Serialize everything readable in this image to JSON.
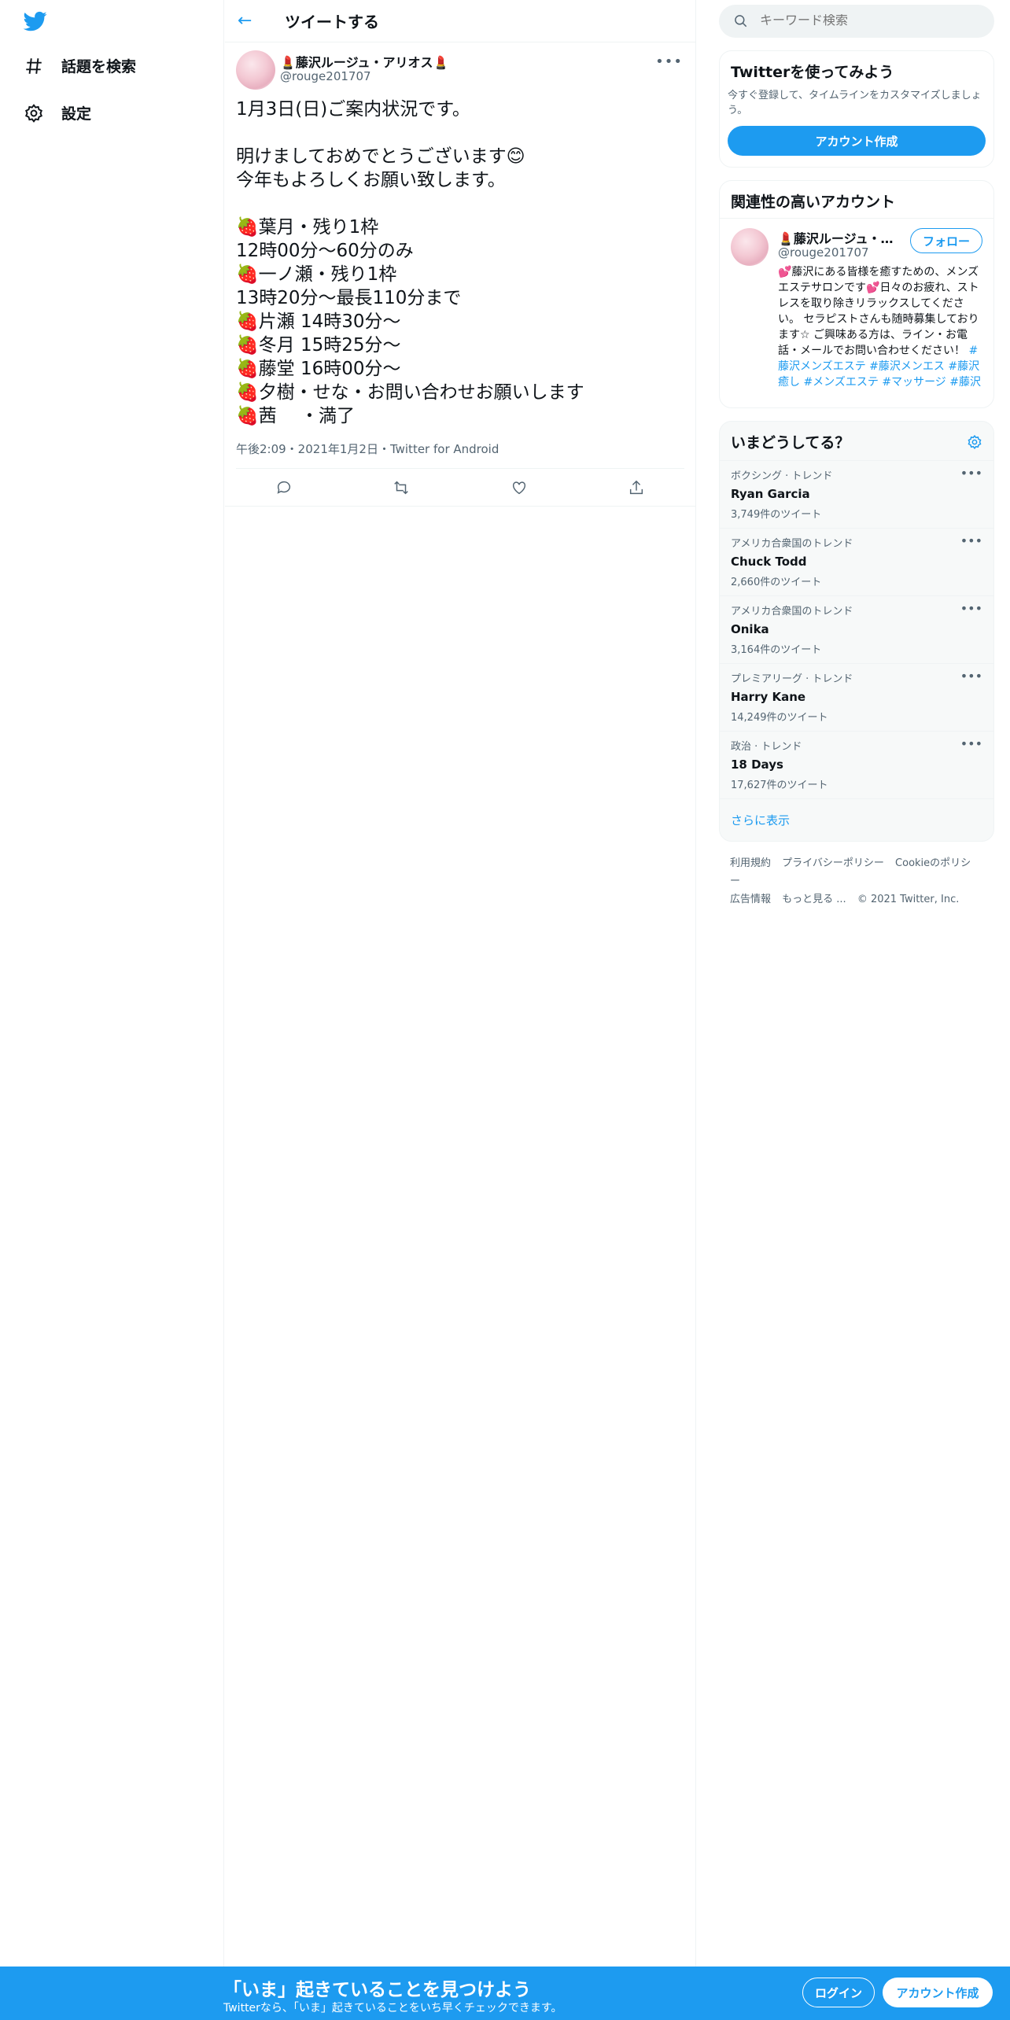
{
  "nav": {
    "explore_label": "話題を検索",
    "settings_label": "設定"
  },
  "main": {
    "title": "ツイートする",
    "tweet": {
      "author_name": "💄藤沢ルージュ・アリオス💄",
      "author_handle": "@rouge201707",
      "body": "1月3日(日)ご案内状況です。\n\n明けましておめでとうございます😊\n今年もよろしくお願い致します。\n\n🍓葉月・残り1枠\n12時00分～60分のみ\n🍓一ノ瀬・残り1枠\n13時20分～最長110分まで\n🍓片瀬 14時30分〜\n🍓冬月 15時25分～\n🍓藤堂 16時00分～\n🍓夕樹・せな・お問い合わせお願いします\n🍓茜　 ・満了",
      "meta": "午後2:09・2021年1月2日・Twitter for Android"
    }
  },
  "right": {
    "search_placeholder": "キーワード検索",
    "signup_card": {
      "title": "Twitterを使ってみよう",
      "subtitle": "今すぐ登録して、タイムラインをカスタマイズしましょう。",
      "button": "アカウント作成"
    },
    "related": {
      "title": "関連性の高いアカウント",
      "name": "💄藤沢ルージュ・ア...",
      "handle": "@rouge201707",
      "follow": "フォロー",
      "bio": "💕藤沢にある皆様を癒すための、メンズエステサロンです💕日々のお疲れ、ストレスを取り除きリラックスしてください。 セラピストさんも随時募集しております☆ ご興味ある方は、ライン・お電話・メールでお問い合わせください！",
      "hashtags": "#藤沢メンズエステ #藤沢メンエス #藤沢癒し #メンズエステ #マッサージ #藤沢"
    },
    "trends": {
      "title": "いまどうしてる？",
      "items": [
        {
          "context": "ボクシング · トレンド",
          "name": "Ryan Garcia",
          "count": "3,749件のツイート"
        },
        {
          "context": "アメリカ合衆国のトレンド",
          "name": "Chuck Todd",
          "count": "2,660件のツイート"
        },
        {
          "context": "アメリカ合衆国のトレンド",
          "name": "Onika",
          "count": "3,164件のツイート"
        },
        {
          "context": "プレミアリーグ · トレンド",
          "name": "Harry Kane",
          "count": "14,249件のツイート"
        },
        {
          "context": "政治 · トレンド",
          "name": "18 Days",
          "count": "17,627件のツイート"
        }
      ],
      "show_more": "さらに表示"
    },
    "footer": {
      "terms": "利用規約",
      "privacy": "プライバシーポリシー",
      "cookie": "Cookieのポリシー",
      "ads": "広告情報",
      "more": "もっと見る ...",
      "copyright": "© 2021 Twitter, Inc."
    }
  },
  "bottom": {
    "title": "「いま」起きていることを見つけよう",
    "subtitle": "Twitterなら、「いま」起きていることをいち早くチェックできます。",
    "login": "ログイン",
    "signup": "アカウント作成"
  },
  "colors": {
    "brand": "#1d9bf0",
    "text": "#0f1419",
    "muted": "#536471"
  }
}
